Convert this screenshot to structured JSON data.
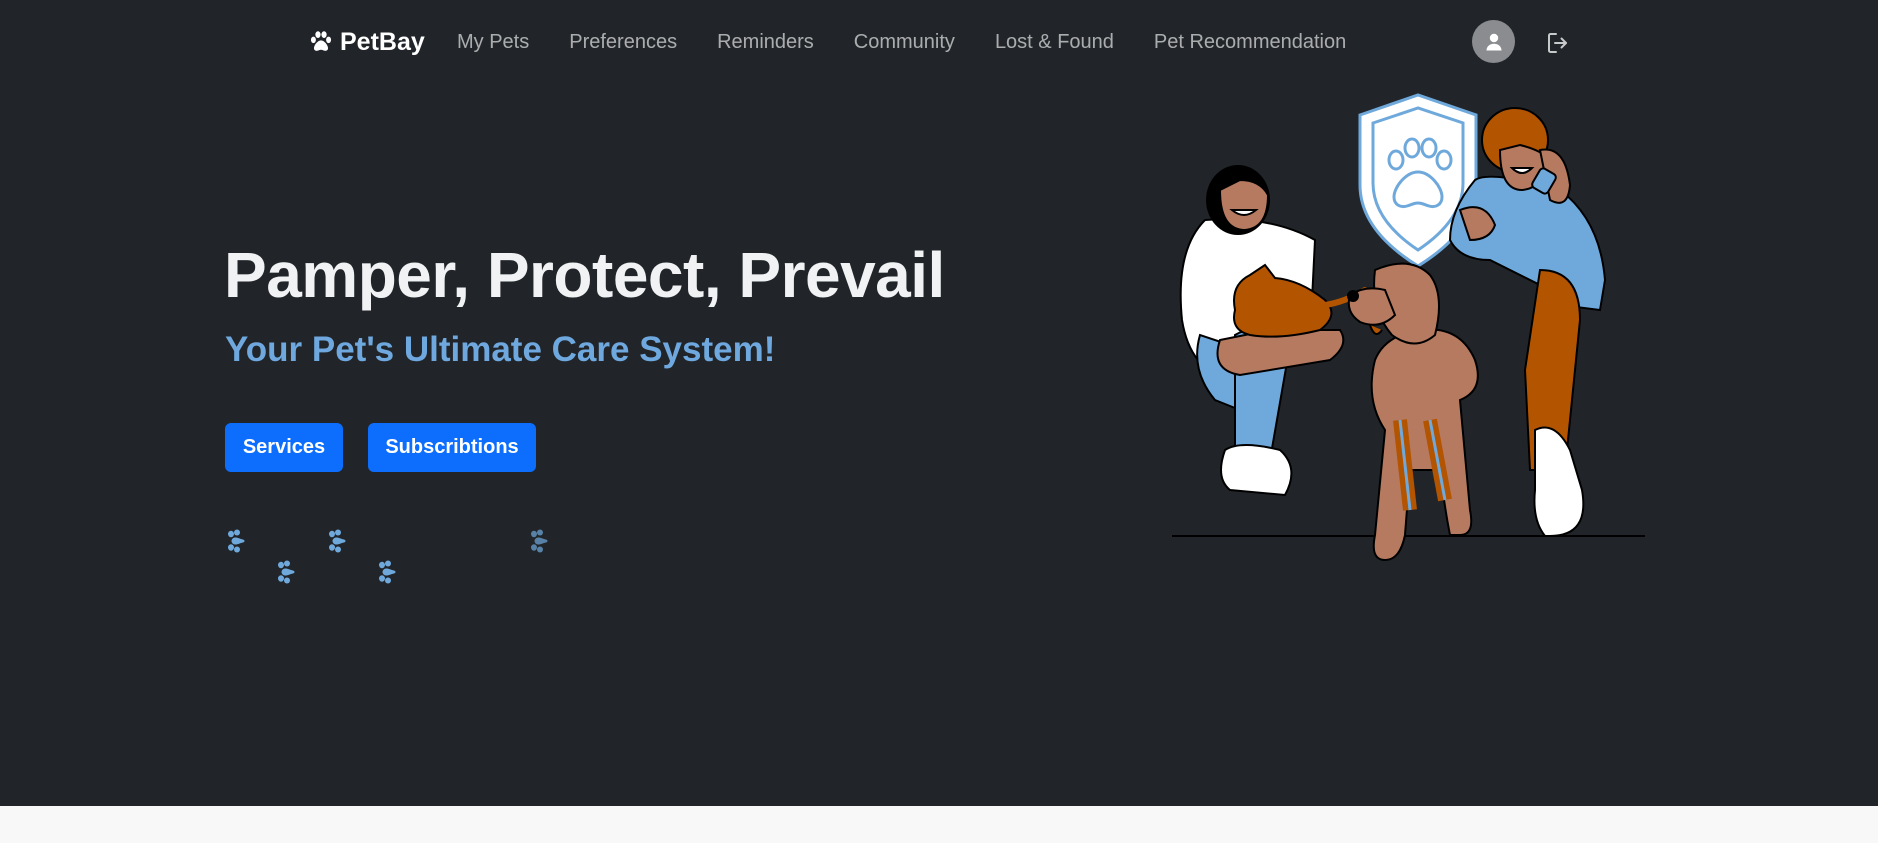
{
  "navbar": {
    "brand": "PetBay",
    "links": [
      "My Pets",
      "Preferences",
      "Reminders",
      "Community",
      "Lost & Found",
      "Pet Recommendation"
    ]
  },
  "hero": {
    "title": "Pamper, Protect, Prevail",
    "subtitle": "Your Pet's Ultimate Care System!",
    "buttons": {
      "services": "Services",
      "subscriptions": "Subscribtions"
    }
  },
  "icons": {
    "brand": "paw-icon",
    "user": "user-icon",
    "logout": "logout-icon",
    "decor": "paw-print-icon"
  },
  "colors": {
    "background": "#212529",
    "accent_blue": "#0d6efd",
    "subtitle_blue": "#6ea8de",
    "illustration_blue": "#6fa9dc",
    "illustration_orange": "#b35400",
    "illustration_tan": "#b67a60"
  }
}
